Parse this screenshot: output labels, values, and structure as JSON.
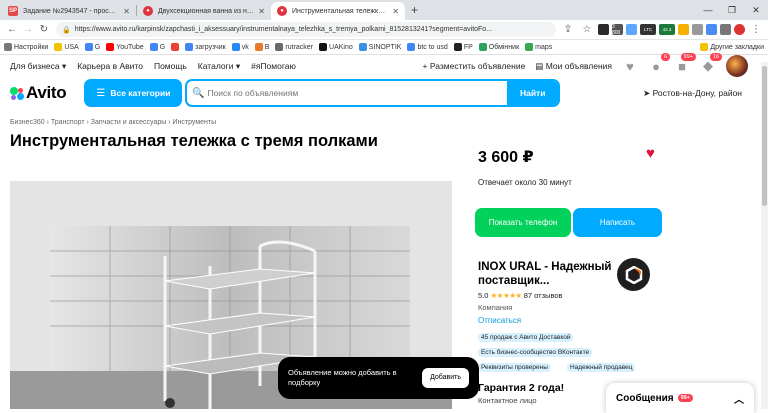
{
  "browser": {
    "tabs": [
      {
        "title": "Задание №2943547 - просмотр з",
        "favicon": "SP",
        "color": "#e24a4a"
      },
      {
        "title": "Двухсекционная ванна из нержа",
        "favicon": "●",
        "color": "#e0333f"
      },
      {
        "title": "Инструментальная тележка с тре",
        "favicon": "●",
        "color": "#e0333f"
      }
    ],
    "new_tab": "+",
    "url": "https://www.avito.ru/karpinsk/zapchasti_i_aksessuary/instrumentalnaya_telezhka_s_tremya_polkami_8152813241?segment=avitoFo...",
    "ext_badges": [
      "LTC",
      "42.3",
      "3 800"
    ],
    "bookmarks": [
      "Настройки",
      "USA",
      "G",
      "YouTube",
      "G",
      "загрузчик",
      "vk",
      "B",
      "rutracker",
      "UAKino",
      "SINOPTIK",
      "btc to usd",
      "FP",
      "Обмінник",
      "maps"
    ],
    "other_bookmarks": "Другие закладки"
  },
  "header": {
    "links": [
      "Для бизнеса",
      "Карьера в Авито",
      "Помощь",
      "Каталоги",
      "#яПомогаю"
    ],
    "post_ad": "Разместить объявление",
    "my_ads": "Мои объявления",
    "badges": {
      "favorites": "",
      "notifications": "6",
      "messages": "99+",
      "cart": "16"
    }
  },
  "search": {
    "logo": "Avito",
    "categories_btn": "Все категории",
    "placeholder": "Поиск по объявлениям",
    "find_btn": "Найти",
    "location": "Ростов-на-Дону, район"
  },
  "breadcrumbs": "Бизнес360 › Транспорт › Запчасти и аксессуары › Инструменты",
  "listing": {
    "title": "Инструментальная тележка с тремя полками",
    "price": "3 600 ₽",
    "reply_time": "Отвечает около 30 минут",
    "show_phone": "Показать телефон",
    "write": "Написать"
  },
  "seller": {
    "name": "INOX URAL - Надежный поставщик...",
    "rating": "5.0",
    "stars": "★★★★★",
    "reviews": "87 отзывов",
    "type": "Компания",
    "subscribe": "Отписаться",
    "chips": [
      "45 продаж с Авито Доставкой",
      "Есть бизнес-сообщество ВКонтакте",
      "Реквизиты проверены",
      "Надежный продавец"
    ],
    "guarantee": "Гарантия 2 года!",
    "contact": "Контактное лицо"
  },
  "toast": {
    "text": "Объявление можно добавить в подборку",
    "button": "Добавить"
  },
  "messages_widget": {
    "label": "Сообщения",
    "badge": "99+"
  },
  "colors": {
    "accent": "#00aaff",
    "green": "#02d15c",
    "heart": "#e5103a"
  }
}
